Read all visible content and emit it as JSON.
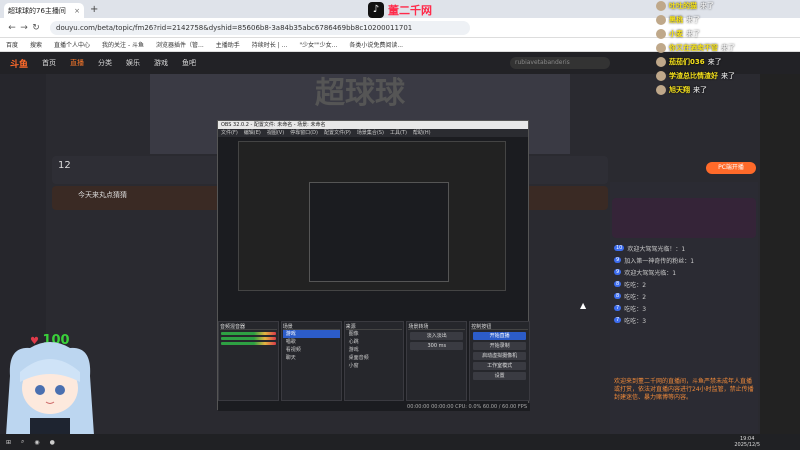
{
  "browser": {
    "tab_title": "超球球的76主播间",
    "url": "douyu.com/beta/topic/fm26?rid=2142758&dyshid=85606b8-3a84b35abc6786469bb8c10200011701",
    "bookmarks": [
      "百度",
      "搜索",
      "直播个人中心",
      "我的关注 - 斗鱼",
      "浏览器插件（管...",
      "主播助手",
      "持续时长 | ...",
      "\"少女\"\"少女...",
      "各类小说免费阅读..."
    ],
    "watermark": "董二千网"
  },
  "site": {
    "brand": "斗鱼",
    "nav": [
      "首页",
      "直播",
      "分类",
      "娱乐",
      "游戏",
      "鱼吧"
    ],
    "search_placeholder": "rubiavetabanderis",
    "banner": "超球球",
    "level": "12",
    "room_name": "今天来丸点猜猜",
    "pc_button": "PC端开播"
  },
  "chat": {
    "rows": [
      {
        "badge": "10",
        "text": "欢迎大驾驾光临！：1"
      },
      {
        "badge": "9",
        "text": "加入第一神奇传的粉丝：1"
      },
      {
        "badge": "9",
        "text": "欢迎大驾驾光临：1"
      },
      {
        "badge": "8",
        "text": "吃吃：2"
      },
      {
        "badge": "8",
        "text": "吃吃：2"
      },
      {
        "badge": "7",
        "text": "吃吃：3"
      },
      {
        "badge": "7",
        "text": "吃吃：3"
      }
    ],
    "welcome": "欢迎来到董二千网的直播间，斗鱼严禁未成年人直播或打赏，依法对直播内容进行24小时监管，禁止传播封建迷信、暴力赌博等内容。"
  },
  "obs": {
    "title": "OBS 32.0.2 - 配置文件: 未命名 - 场景: 未命名",
    "menu": [
      "文件(F)",
      "编辑(E)",
      "视图(V)",
      "停靠窗口(D)",
      "配置文件(P)",
      "场景集合(S)",
      "工具(T)",
      "帮助(H)"
    ],
    "docks": [
      "音频混音器",
      "场景",
      "来源",
      "场景转场",
      "控制按钮"
    ],
    "scenes": [
      "游戏",
      "唱歌",
      "看视频",
      "聊天"
    ],
    "sources": [
      "图像",
      "心跳",
      "游戏",
      "桌面音频",
      "小窗"
    ],
    "controls": [
      "开始直播",
      "开始录制",
      "启动虚拟摄像机",
      "工作室模式",
      "设置"
    ],
    "transition": "淡入淡出",
    "duration": "300 ms",
    "status": "00:00:00  00:00:00  CPU: 0.0%  60.00 / 60.00 FPS"
  },
  "overlay": {
    "users": [
      {
        "name": "吐吐的猫",
        "text": "来了"
      },
      {
        "name": "黑桃",
        "text": "来了"
      },
      {
        "name": "小麦",
        "text": "来了"
      },
      {
        "name": "你又在酒卖不管",
        "text": "来了"
      },
      {
        "name": "茄茄们036",
        "text": "来了"
      },
      {
        "name": "学渣总比情渣好",
        "text": "来了"
      },
      {
        "name": "旭天翔",
        "text": "来了"
      }
    ]
  },
  "hearts": {
    "count": "100"
  },
  "clock": {
    "time": "19:04",
    "date": "2025/12/5"
  }
}
